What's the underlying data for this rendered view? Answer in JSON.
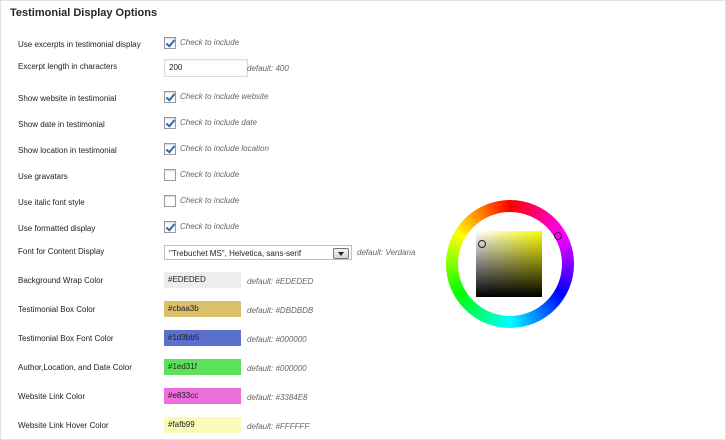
{
  "section_title": "Testimonial Display Options",
  "rows": [
    {
      "label": "Use excerpts in testimonial display",
      "checked": true,
      "hint": "Check to include"
    },
    {
      "label": "Excerpt length in characters",
      "value": "200",
      "hint": "default: 400"
    },
    {
      "label": "Show website in testimonial",
      "checked": true,
      "hint": "Check to include website"
    },
    {
      "label": "Show date in testimonial",
      "checked": true,
      "hint": "Check to include date"
    },
    {
      "label": "Show location in testimonial",
      "checked": true,
      "hint": "Check to include location"
    },
    {
      "label": "Use gravatars",
      "checked": false,
      "hint": "Check to include"
    },
    {
      "label": "Use italic font style",
      "checked": false,
      "hint": "Check to include"
    },
    {
      "label": "Use formatted display",
      "checked": true,
      "hint": "Check to include"
    },
    {
      "label": "Font for Content Display",
      "value": "\"Trebuchet MS\", Helvetica, sans-serif",
      "hint": "default: Verdana"
    },
    {
      "label": "Background Wrap Color",
      "value": "#EDEDED",
      "color": "#EDEDED",
      "hint": "default: #EDEDED"
    },
    {
      "label": "Testimonial Box Color",
      "value": "#cbaa3b",
      "color": "#DBC06C",
      "hint": "default: #DBDBDB"
    },
    {
      "label": "Testimonial Box Font Color",
      "value": "#1d3bb5",
      "color": "#5B6FCF",
      "hint": "default: #000000"
    },
    {
      "label": "Author,Location, and Date Color",
      "value": "#1ed31f",
      "color": "#5CE25A",
      "hint": "default: #000000"
    },
    {
      "label": "Website Link Color",
      "value": "#e833cc",
      "color": "#EC6FDB",
      "hint": "default: #3384E8"
    },
    {
      "label": "Website Link Hover Color",
      "value": "#fafb99",
      "color": "#FAFBB8",
      "hint": "default: #FFFFFF"
    }
  ],
  "colors": {
    "checkbox_check": "#2b6cb0",
    "title": "#23282d"
  }
}
